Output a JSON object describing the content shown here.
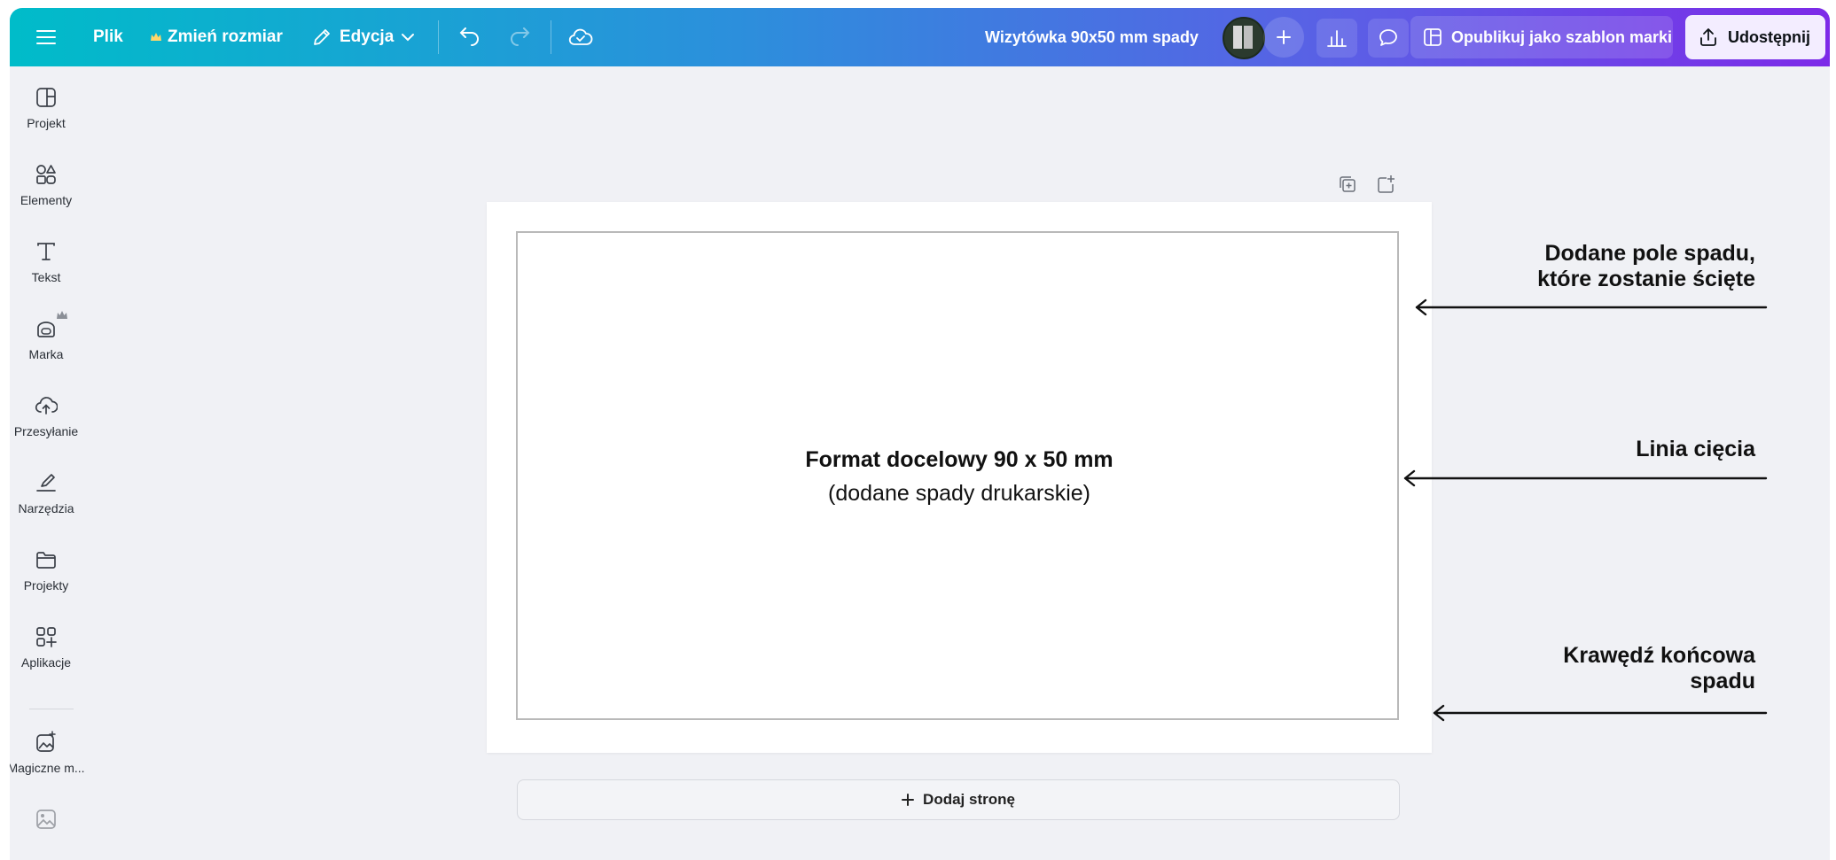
{
  "topbar": {
    "menu_icon": "hamburger-icon",
    "file_label": "Plik",
    "resize_label": "Zmień rozmiar",
    "edit_label": "Edycja",
    "doc_title": "Wizytówka 90x50 mm spady",
    "publish_label": "Opublikuj jako szablon marki",
    "share_label": "Udostępnij"
  },
  "sidebar": {
    "items": [
      {
        "label": "Projekt",
        "icon": "layout-icon"
      },
      {
        "label": "Elementy",
        "icon": "shapes-icon"
      },
      {
        "label": "Tekst",
        "icon": "text-icon"
      },
      {
        "label": "Marka",
        "icon": "brand-icon"
      },
      {
        "label": "Przesyłanie",
        "icon": "upload-cloud-icon"
      },
      {
        "label": "Narzędzia",
        "icon": "draw-icon"
      },
      {
        "label": "Projekty",
        "icon": "folder-icon"
      },
      {
        "label": "Aplikacje",
        "icon": "apps-icon"
      },
      {
        "label": "Magiczne m...",
        "icon": "magic-media-icon"
      }
    ]
  },
  "canvas": {
    "title": "Format docelowy 90 x 50 mm",
    "subtitle": "(dodane spady drukarskie)",
    "add_page_label": "Dodaj stronę"
  },
  "annotations": {
    "bleed_area_line1": "Dodane pole spadu,",
    "bleed_area_line2": "które zostanie ścięte",
    "cut_line": "Linia cięcia",
    "bleed_edge_line1": "Krawędź końcowa",
    "bleed_edge_line2": "spadu"
  },
  "colors": {
    "topbar_gradient_start": "#00bcc9",
    "topbar_gradient_end": "#7d2ae8",
    "workspace_bg": "#f0f1f5",
    "share_button_bg": "#f3edff"
  }
}
